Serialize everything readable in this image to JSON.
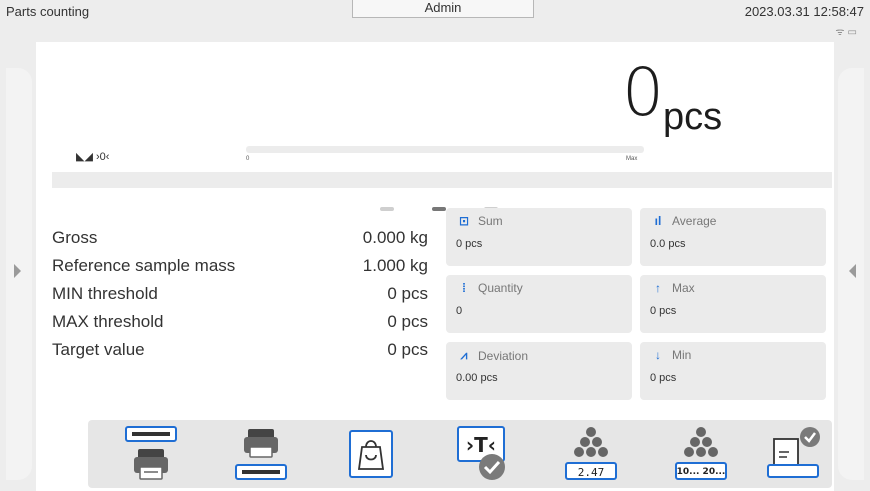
{
  "topbar": {
    "mode": "Parts counting",
    "user": "Admin",
    "datetime": "2023.03.31 12:58:47",
    "status_icons": [
      "wifi-icon",
      "computer-icon"
    ]
  },
  "weighing": {
    "value": "0",
    "unit": "pcs",
    "indicators": "◣◢ ›0‹",
    "bar_min": "0",
    "bar_max": "Max",
    "bar_fill_fraction": 0
  },
  "pager": {
    "pages": 3,
    "active": 1
  },
  "params": [
    {
      "label": "Gross",
      "value": "0.000 kg"
    },
    {
      "label": "Reference sample mass",
      "value": "1.000 kg"
    },
    {
      "label": "MIN threshold",
      "value": "0 pcs"
    },
    {
      "label": "MAX threshold",
      "value": "0 pcs"
    },
    {
      "label": "Target value",
      "value": "0 pcs"
    }
  ],
  "tiles": {
    "sum": {
      "title": "Sum",
      "value": "0 pcs",
      "icon": "scale-sum-icon"
    },
    "average": {
      "title": "Average",
      "value": "0.0 pcs",
      "icon": "bar-chart-icon"
    },
    "quantity": {
      "title": "Quantity",
      "value": "0",
      "icon": "quantity-icon"
    },
    "max": {
      "title": "Max",
      "value": "0 pcs",
      "icon": "arrow-up-icon"
    },
    "deviation": {
      "title": "Deviation",
      "value": "0.00 pcs",
      "icon": "line-chart-icon"
    },
    "min": {
      "title": "Min",
      "value": "0 pcs",
      "icon": "arrow-down-icon"
    }
  },
  "toolbar": {
    "buttons": [
      "header-printout-button",
      "footer-printout-button",
      "tare-bag-button",
      "tare-confirm-button",
      "apw-button",
      "sample-quantity-button",
      "product-database-button"
    ],
    "apw_label": "2.47",
    "sample_label": "10... 20..."
  },
  "colors": {
    "accent": "#1f6ed4",
    "background": "#ededed",
    "panel": "#ffffff",
    "tile": "#ebebeb"
  }
}
